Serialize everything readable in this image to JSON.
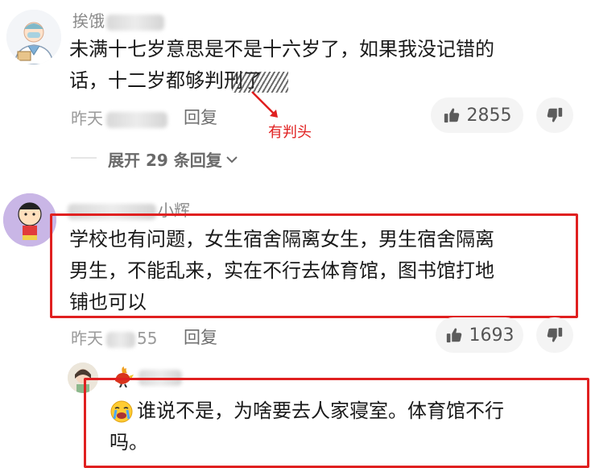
{
  "comments": [
    {
      "username": "挨饿",
      "text_line1": "未满十七岁意思是不是十六岁了，如果我没记错的",
      "text_line2": "话，十二岁都够判刑了",
      "time_prefix": "昨天",
      "reply_label": "回复",
      "likes": "2855",
      "expand_label": "展开 29 条回复"
    },
    {
      "username_suffix": "小辉",
      "text_line1": "学校也有问题，女生宿舍隔离女生，男生宿舍隔离",
      "text_line2": "男生，不能乱来，实在不行去体育馆，图书馆打地",
      "text_line3": "铺也可以",
      "time_prefix": "昨天",
      "time_suffix": "55",
      "reply_label": "回复",
      "likes": "1693"
    }
  ],
  "reply": {
    "emoji": "😭",
    "text_line1": "谁说不是，为啥要去人家寝室。体育馆不行",
    "text_line2": "吗。"
  },
  "annotation": {
    "label": "有判头",
    "color": "#e02020"
  },
  "icons": {
    "like": "thumbs-up-icon",
    "dislike": "thumbs-down-icon",
    "expand": "chevron-down-icon"
  }
}
